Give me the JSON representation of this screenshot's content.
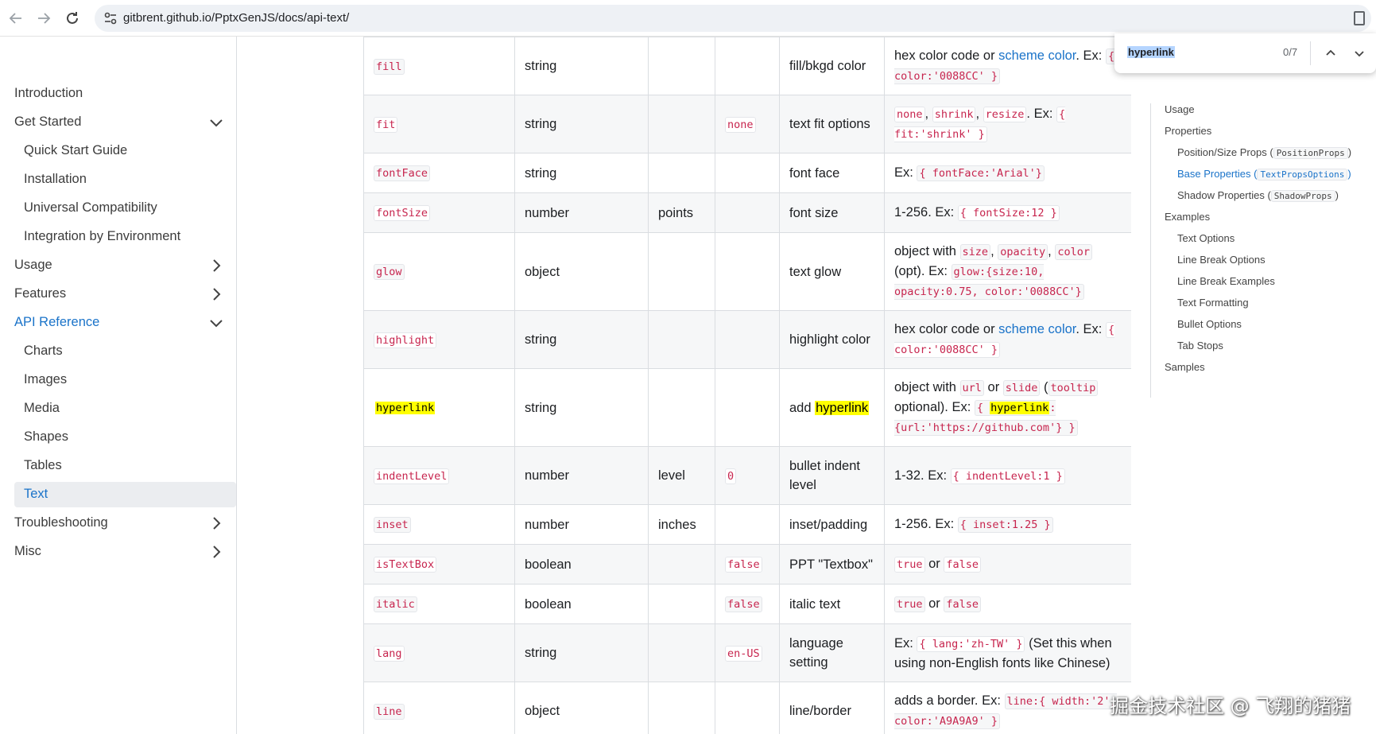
{
  "browser": {
    "url": "gitbrent.github.io/PptxGenJS/docs/api-text/"
  },
  "sidebar": {
    "items": [
      {
        "label": "Introduction",
        "level": "top",
        "chevron": null
      },
      {
        "label": "Get Started",
        "level": "top",
        "chevron": "down"
      },
      {
        "label": "Quick Start Guide",
        "level": "sub",
        "chevron": null
      },
      {
        "label": "Installation",
        "level": "sub",
        "chevron": null
      },
      {
        "label": "Universal Compatibility",
        "level": "sub",
        "chevron": null
      },
      {
        "label": "Integration by Environment",
        "level": "sub",
        "chevron": null
      },
      {
        "label": "Usage",
        "level": "top",
        "chevron": "right"
      },
      {
        "label": "Features",
        "level": "top",
        "chevron": "right"
      },
      {
        "label": "API Reference",
        "level": "top",
        "chevron": "down",
        "active": true
      },
      {
        "label": "Charts",
        "level": "sub",
        "chevron": null
      },
      {
        "label": "Images",
        "level": "sub",
        "chevron": null
      },
      {
        "label": "Media",
        "level": "sub",
        "chevron": null
      },
      {
        "label": "Shapes",
        "level": "sub",
        "chevron": null
      },
      {
        "label": "Tables",
        "level": "sub",
        "chevron": null
      },
      {
        "label": "Text",
        "level": "sub",
        "chevron": null,
        "active": true
      },
      {
        "label": "Troubleshooting",
        "level": "top",
        "chevron": "right"
      },
      {
        "label": "Misc",
        "level": "top",
        "chevron": "right"
      }
    ]
  },
  "table": {
    "rows": [
      {
        "option": "fill",
        "type": "string",
        "unit": "",
        "default": "",
        "description": "fill/bkgd color",
        "values": [
          {
            "t": "hex color code or "
          },
          {
            "l": "scheme color"
          },
          {
            "t": ". Ex: "
          },
          {
            "c": "{ color:'0088CC' }"
          }
        ]
      },
      {
        "option": "fit",
        "type": "string",
        "unit": "",
        "default": "none",
        "description": "text fit options",
        "values": [
          {
            "c": "none"
          },
          {
            "t": ", "
          },
          {
            "c": "shrink"
          },
          {
            "t": ", "
          },
          {
            "c": "resize"
          },
          {
            "t": ". Ex: "
          },
          {
            "c": "{ fit:'shrink' }"
          }
        ]
      },
      {
        "option": "fontFace",
        "type": "string",
        "unit": "",
        "default": "",
        "description": "font face",
        "values": [
          {
            "t": "Ex: "
          },
          {
            "c": "{ fontFace:'Arial'}"
          }
        ]
      },
      {
        "option": "fontSize",
        "type": "number",
        "unit": "points",
        "default": "",
        "description": "font size",
        "values": [
          {
            "t": "1-256. Ex: "
          },
          {
            "c": "{ fontSize:12 }"
          }
        ]
      },
      {
        "option": "glow",
        "type": "object",
        "unit": "",
        "default": "",
        "description": "text glow",
        "values": [
          {
            "t": "object with "
          },
          {
            "c": "size"
          },
          {
            "t": ", "
          },
          {
            "c": "opacity"
          },
          {
            "t": ", "
          },
          {
            "c": "color"
          },
          {
            "t": " (opt). Ex: "
          },
          {
            "c": "glow:{size:10, opacity:0.75, color:'0088CC'}"
          }
        ]
      },
      {
        "option": "highlight",
        "type": "string",
        "unit": "",
        "default": "",
        "description": "highlight color",
        "values": [
          {
            "t": "hex color code or "
          },
          {
            "l": "scheme color"
          },
          {
            "t": ". Ex: "
          },
          {
            "c": "{ color:'0088CC' }"
          }
        ]
      },
      {
        "option": "hyperlink",
        "type": "string",
        "unit": "",
        "default": "",
        "description_prefix": "add ",
        "description_mark": "hyperlink",
        "description": "",
        "values": [
          {
            "t": "object with "
          },
          {
            "c": "url"
          },
          {
            "t": " or "
          },
          {
            "c": "slide"
          },
          {
            "t": " ("
          },
          {
            "c": "tooltip"
          },
          {
            "t": " optional). Ex: "
          },
          {
            "cm": [
              "{ ",
              "hyperlink",
              ": {url:'https://github.com'} }"
            ]
          }
        ]
      },
      {
        "option": "indentLevel",
        "type": "number",
        "unit": "level",
        "default": "0",
        "description": "bullet indent level",
        "values": [
          {
            "t": "1-32. Ex: "
          },
          {
            "c": "{ indentLevel:1 }"
          }
        ]
      },
      {
        "option": "inset",
        "type": "number",
        "unit": "inches",
        "default": "",
        "description": "inset/padding",
        "values": [
          {
            "t": "1-256. Ex: "
          },
          {
            "c": "{ inset:1.25 }"
          }
        ]
      },
      {
        "option": "isTextBox",
        "type": "boolean",
        "unit": "",
        "default": "false",
        "description": "PPT \"Textbox\"",
        "values": [
          {
            "c": "true"
          },
          {
            "t": " or "
          },
          {
            "c": "false"
          }
        ]
      },
      {
        "option": "italic",
        "type": "boolean",
        "unit": "",
        "default": "false",
        "description": "italic text",
        "values": [
          {
            "c": "true"
          },
          {
            "t": " or "
          },
          {
            "c": "false"
          }
        ]
      },
      {
        "option": "lang",
        "type": "string",
        "unit": "",
        "default": "en-US",
        "description": "language setting",
        "values": [
          {
            "t": "Ex: "
          },
          {
            "c": "{ lang:'zh-TW' }"
          },
          {
            "t": " (Set this when using non-English fonts like Chinese)"
          }
        ]
      },
      {
        "option": "line",
        "type": "object",
        "unit": "",
        "default": "",
        "description": "line/border",
        "values": [
          {
            "t": "adds a border. Ex: "
          },
          {
            "c": "line:{ width:'2', color:'A9A9A9' }"
          }
        ]
      }
    ]
  },
  "toc": {
    "items": [
      {
        "label": "Usage",
        "level": 1
      },
      {
        "label": "Properties",
        "level": 1
      },
      {
        "label": "Position/Size Props",
        "code": "PositionProps",
        "level": 2
      },
      {
        "label": "Base Properties",
        "code": "TextPropsOptions",
        "level": 2,
        "active": true
      },
      {
        "label": "Shadow Properties",
        "code": "ShadowProps",
        "level": 2
      },
      {
        "label": "Examples",
        "level": 1
      },
      {
        "label": "Text Options",
        "level": 2
      },
      {
        "label": "Line Break Options",
        "level": 2
      },
      {
        "label": "Line Break Examples",
        "level": 2
      },
      {
        "label": "Text Formatting",
        "level": 2
      },
      {
        "label": "Bullet Options",
        "level": 2
      },
      {
        "label": "Tab Stops",
        "level": 2
      },
      {
        "label": "Samples",
        "level": 1
      }
    ]
  },
  "find": {
    "query": "hyperlink",
    "count": "0/7"
  },
  "watermark": "掘金技术社区 @ 飞翔的猪猪"
}
